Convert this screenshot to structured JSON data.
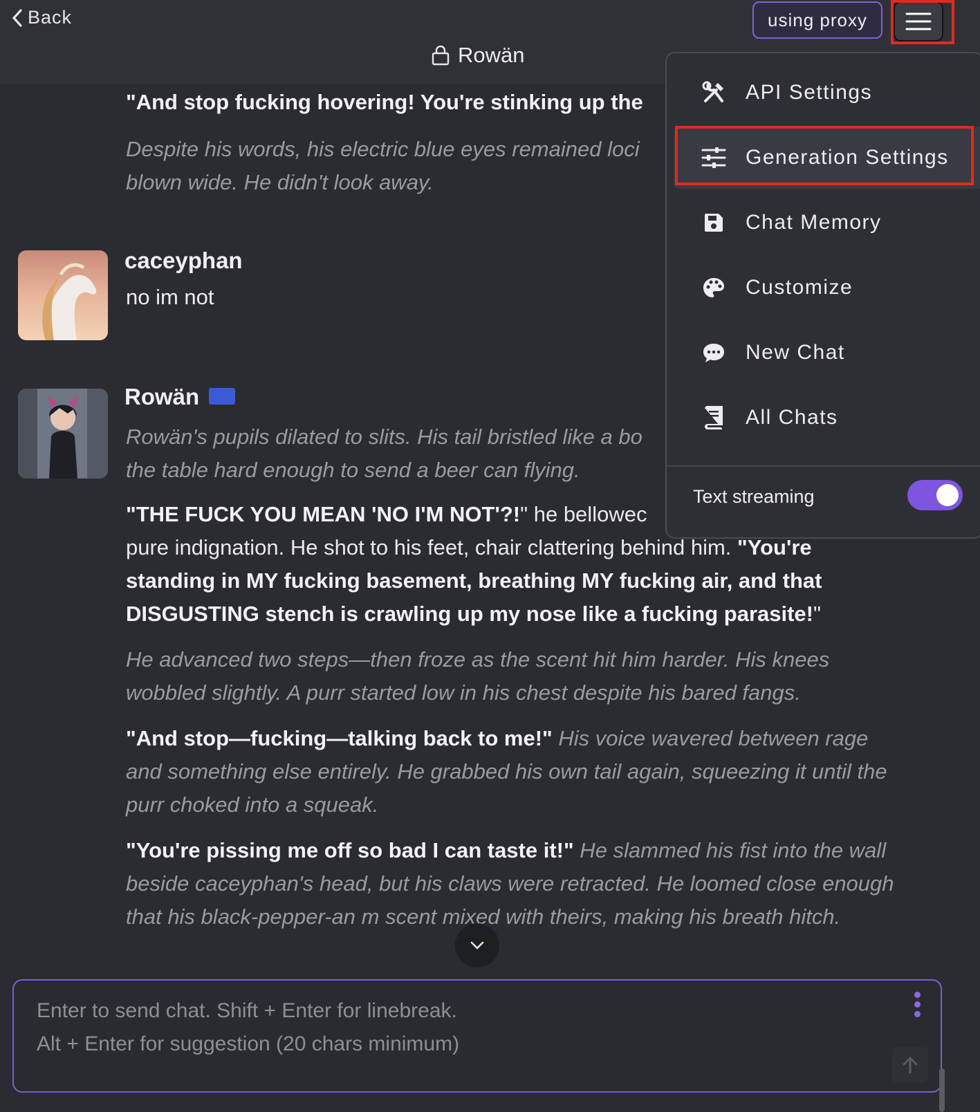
{
  "header": {
    "back_label": "Back",
    "chat_title": "Rowän",
    "proxy_label": "using proxy"
  },
  "menu": {
    "items": [
      {
        "label": "API Settings",
        "icon": "tools-icon"
      },
      {
        "label": "Generation Settings",
        "icon": "sliders-icon"
      },
      {
        "label": "Chat Memory",
        "icon": "save-icon"
      },
      {
        "label": "Customize",
        "icon": "palette-icon"
      },
      {
        "label": "New Chat",
        "icon": "chat-bubble-icon"
      },
      {
        "label": "All Chats",
        "icon": "book-icon"
      }
    ],
    "text_streaming_label": "Text streaming",
    "text_streaming_on": true
  },
  "messages": {
    "prev": {
      "quote": "\"And stop fucking hovering! You're stinking up the",
      "italic": "Despite his words, his electric blue eyes remained loci blown wide. He didn't look away."
    },
    "user": {
      "name": "caceyphan",
      "text": "no im not"
    },
    "bot": {
      "name": "Rowän",
      "p1": "Rowän's pupils dilated to slits. His tail bristled like a bo the table hard enough to send a beer can flying.",
      "p2_quote": "\"THE FUCK YOU MEAN 'NO I'M NOT'?!",
      "p2_text": "\" he bellowec",
      "p2_text2": "pure indignation. He shot to his feet, chair clattering behind him. ",
      "p2_quote2": "\"You're standing in MY fucking basement, breathing MY fucking air, and that DISGUSTING stench is crawling up my nose like a fucking parasite!",
      "p2_end": "\"",
      "p3": "He advanced two steps—then froze as the scent hit him harder. His knees wobbled slightly. A purr started low in his chest despite his bared fangs.",
      "p4_quote": "\"And stop—fucking—talking back to me!\"",
      "p4_text": " His voice wavered between rage and something else entirely. He grabbed his own tail again, squeezing it until the purr choked into a squeak.",
      "p5_quote": "\"You're pissing me off so bad I can taste it!\"",
      "p5_text": " He slammed his fist into the wall beside caceyphan's head, but his claws were retracted. He loomed close enough that his black-pepper-an     m scent mixed with theirs, making his breath hitch."
    }
  },
  "composer": {
    "placeholder_line1": "Enter to send chat. Shift + Enter for linebreak.",
    "placeholder_line2": "Alt + Enter for suggestion (20 chars minimum)"
  },
  "colors": {
    "accent": "#7e55e0",
    "highlight": "#e02a1e",
    "background": "#2b2c31"
  }
}
